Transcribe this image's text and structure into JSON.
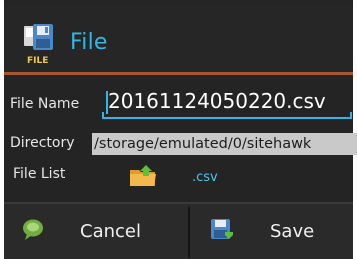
{
  "dialog": {
    "title": "File",
    "title_icon": "floppy-file-icon",
    "icon_badge": "FILE"
  },
  "form": {
    "file_name_label": "File Name",
    "file_name_value": "20161124050220.csv",
    "directory_label": "Directory",
    "directory_value": "/storage/emulated/0/sitehawk",
    "file_list_label": "File List",
    "file_list_icon": "folder-up-icon",
    "extension": ".csv"
  },
  "buttons": {
    "cancel_label": "Cancel",
    "cancel_icon": "cancel-bubble-icon",
    "save_label": "Save",
    "save_icon": "save-disk-icon"
  },
  "colors": {
    "accent": "#35b5e5",
    "divider": "#a5562d",
    "background": "#242424"
  }
}
